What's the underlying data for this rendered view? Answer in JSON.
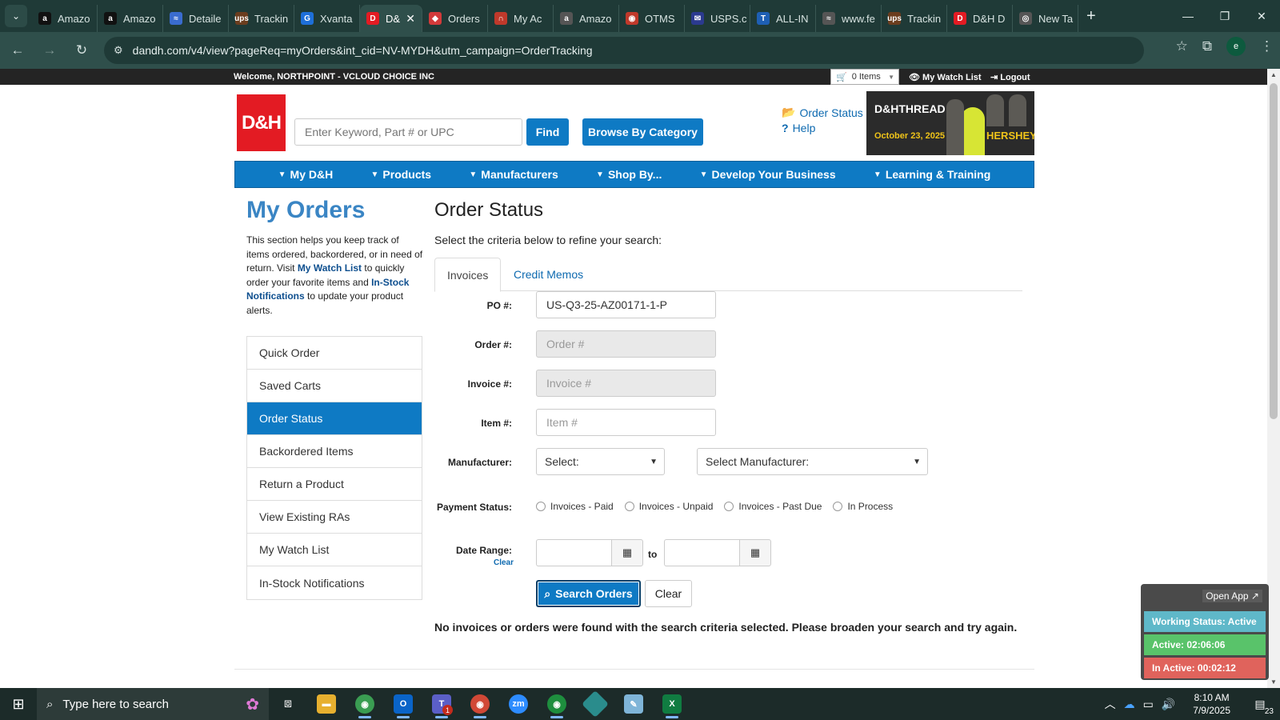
{
  "browser": {
    "tabs": [
      {
        "label": "Amazo",
        "fav": "a",
        "color": "#111"
      },
      {
        "label": "Amazo",
        "fav": "a",
        "color": "#111"
      },
      {
        "label": "Detaile",
        "fav": "≈",
        "color": "#3a6ccf"
      },
      {
        "label": "Trackin",
        "fav": "ups",
        "color": "#6b3d1e"
      },
      {
        "label": "Xvanta",
        "fav": "G",
        "color": "#1e6fd9"
      },
      {
        "label": "D&",
        "fav": "D",
        "color": "#e31b23",
        "active": true
      },
      {
        "label": "Orders",
        "fav": "◆",
        "color": "#d23a3a"
      },
      {
        "label": "My Ac",
        "fav": "∩",
        "color": "#c0392b"
      },
      {
        "label": "Amazo",
        "fav": "a",
        "color": "#555"
      },
      {
        "label": "OTMS",
        "fav": "◉",
        "color": "#c0392b"
      },
      {
        "label": "USPS.c",
        "fav": "✉",
        "color": "#2b3a8f"
      },
      {
        "label": "ALL-IN",
        "fav": "T",
        "color": "#1e5fb4"
      },
      {
        "label": "www.fe",
        "fav": "≈",
        "color": "#555"
      },
      {
        "label": "Trackin",
        "fav": "ups",
        "color": "#6b3d1e"
      },
      {
        "label": "D&H D",
        "fav": "D",
        "color": "#e31b23"
      },
      {
        "label": "New Ta",
        "fav": "◎",
        "color": "#555"
      }
    ],
    "url": "dandh.com/v4/view?pageReq=myOrders&int_cid=NV-MYDH&utm_campaign=OrderTracking",
    "profile_initial": "e"
  },
  "topbar": {
    "welcome": "Welcome, NORTHPOINT - VCLOUD CHOICE INC",
    "cart": "0 Items",
    "watch_list": "My Watch List",
    "logout": "Logout"
  },
  "header": {
    "logo": "D&H",
    "search_placeholder": "Enter Keyword, Part # or UPC",
    "find": "Find",
    "browse": "Browse By Category",
    "order_status_link": "Order Status",
    "help_link": "Help",
    "banner": {
      "brand": "D&HTHREAD",
      "date": "October 23, 2025",
      "place": "HERSHEY"
    }
  },
  "mainnav": [
    "My D&H",
    "Products",
    "Manufacturers",
    "Shop By...",
    "Develop Your Business",
    "Learning & Training"
  ],
  "sidebar": {
    "title": "My Orders",
    "desc_1": "This section helps you keep track of items ordered, backordered, or in need of return. Visit ",
    "desc_link1": "My Watch List",
    "desc_2": " to quickly order your favorite items and ",
    "desc_link2": "In-Stock Notifications",
    "desc_3": " to update your product alerts.",
    "items": [
      "Quick Order",
      "Saved Carts",
      "Order Status",
      "Backordered Items",
      "Return a Product",
      "View Existing RAs",
      "My Watch List",
      "In-Stock Notifications"
    ],
    "active_item": "Order Status"
  },
  "main": {
    "title": "Order Status",
    "subtitle": "Select the criteria below to refine your search:",
    "tabs": [
      "Invoices",
      "Credit Memos"
    ],
    "form": {
      "po_label": "PO #:",
      "po_value": "US-Q3-25-AZ00171-1-P",
      "order_label": "Order #:",
      "order_placeholder": "Order #",
      "invoice_label": "Invoice #:",
      "invoice_placeholder": "Invoice #",
      "item_label": "Item #:",
      "item_placeholder": "Item #",
      "manufacturer_label": "Manufacturer:",
      "select_1": "Select:",
      "select_2": "Select Manufacturer:",
      "payment_label": "Payment Status:",
      "payment_options": [
        "Invoices - Paid",
        "Invoices - Unpaid",
        "Invoices - Past Due",
        "In Process"
      ],
      "date_label": "Date Range:",
      "date_clear": "Clear",
      "date_to": "to",
      "search_btn": "Search Orders",
      "clear_btn": "Clear"
    },
    "no_results": "No invoices or orders were found with the search criteria selected. Please broaden your search and try again."
  },
  "widget": {
    "open_app": "Open App ↗",
    "working_status": "Working Status: Active",
    "active": "Active: 02:06:06",
    "inactive": "In Active: 00:02:12",
    "colors": {
      "working": "#5fb8c9",
      "active": "#59c36a",
      "inactive": "#e0635c"
    }
  },
  "taskbar": {
    "search_placeholder": "Type here to search",
    "time": "8:10 AM",
    "date": "7/9/2025",
    "notifications": "23",
    "teams_badge": "1"
  }
}
